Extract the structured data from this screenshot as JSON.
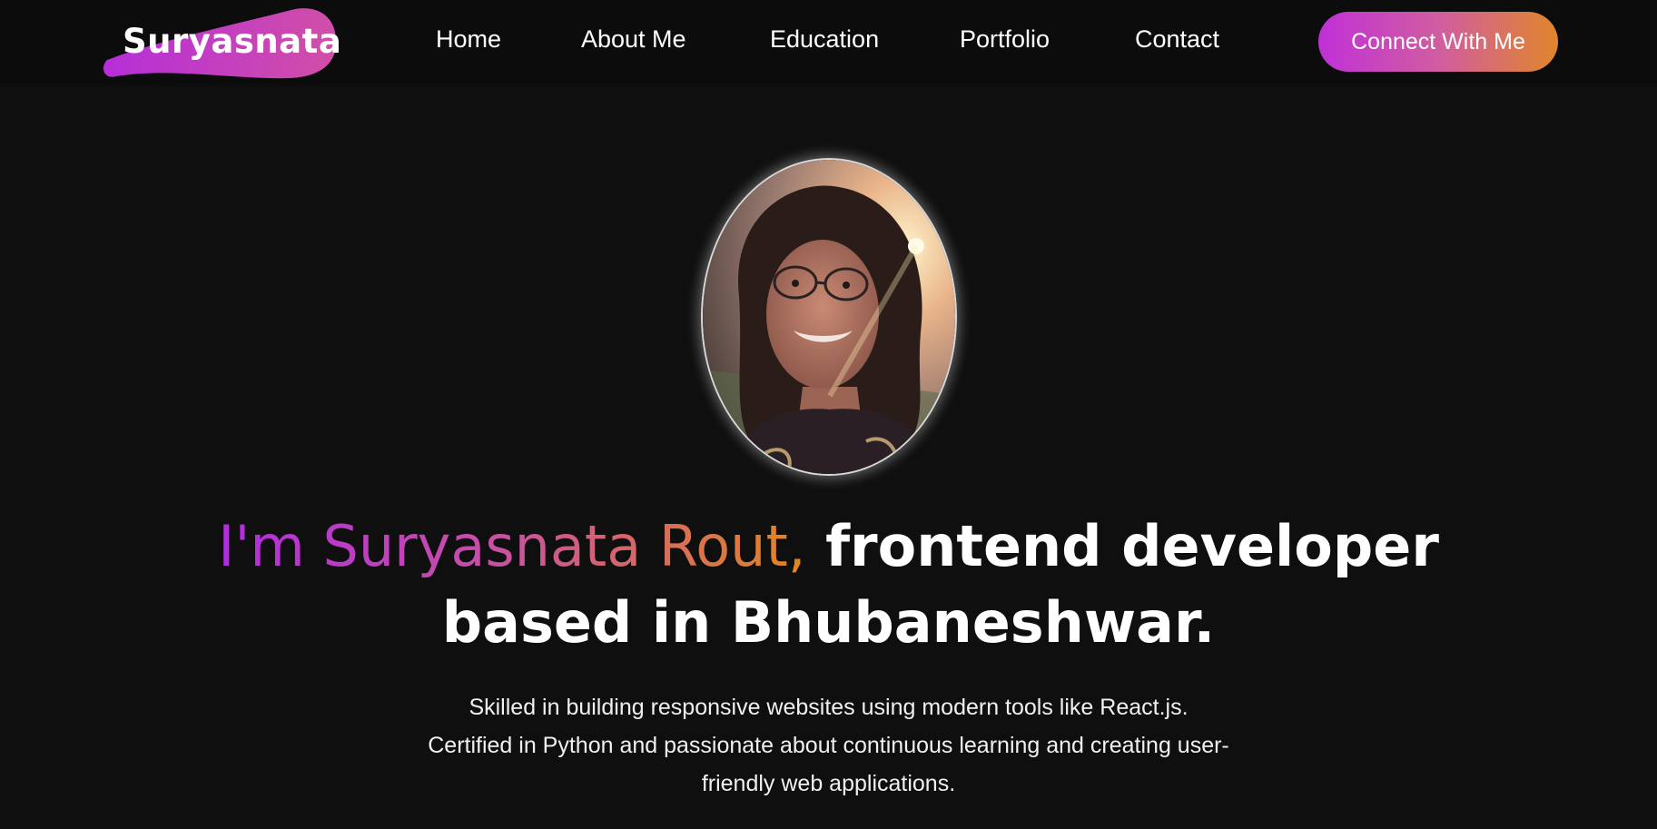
{
  "nav": {
    "logo": "Suryasnata",
    "items": [
      {
        "label": "Home"
      },
      {
        "label": "About Me"
      },
      {
        "label": "Education"
      },
      {
        "label": "Portfolio"
      },
      {
        "label": "Contact"
      }
    ],
    "cta": "Connect With Me"
  },
  "hero": {
    "name_part": "I'm Suryasnata Rout,",
    "role_part": " frontend developer",
    "location_line": "based in Bhubaneshwar.",
    "description": "Skilled in building responsive websites using modern tools like React.js. Certified in Python and passionate about continuous learning and creating user-friendly web applications."
  },
  "colors": {
    "background": "#0f0f0f",
    "accent_start": "#c030d8",
    "accent_end": "#e0862a"
  }
}
